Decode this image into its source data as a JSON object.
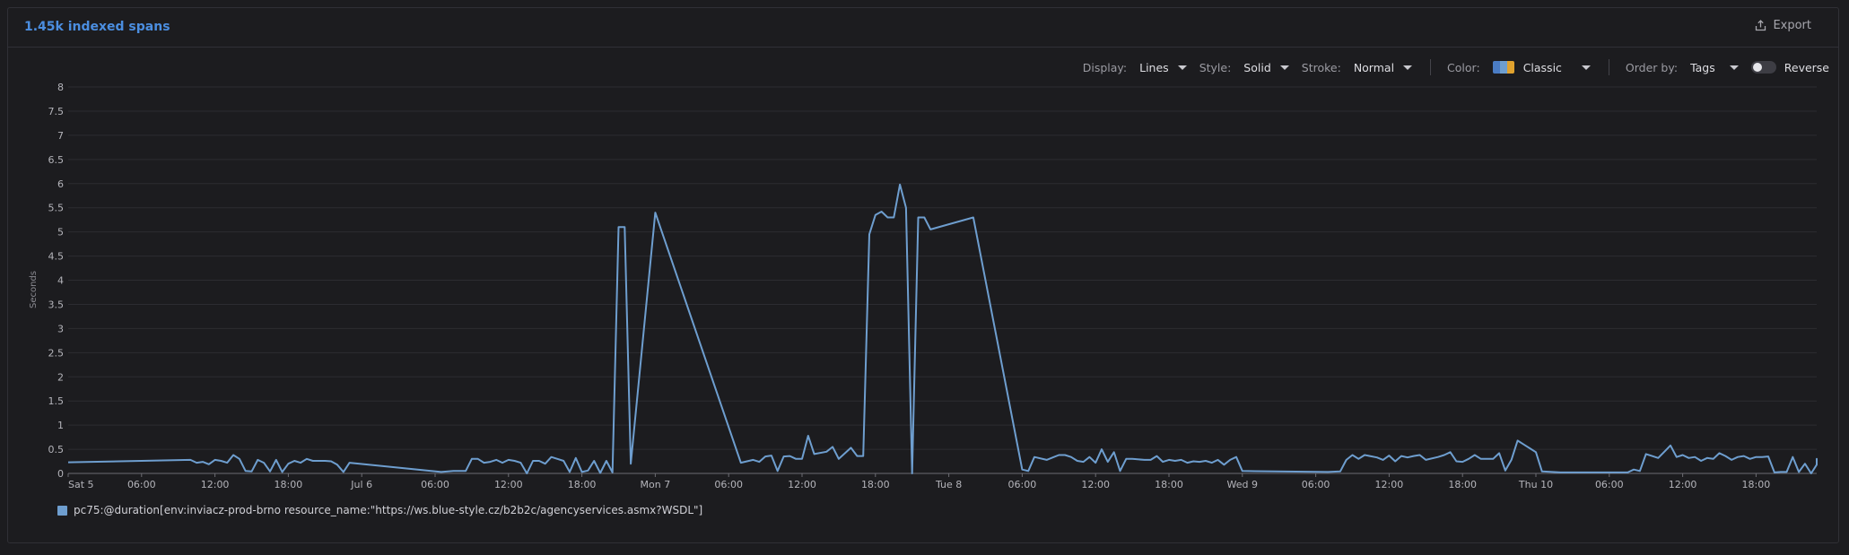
{
  "header": {
    "title": "1.45k indexed spans",
    "export_label": "Export"
  },
  "toolbar": {
    "display_label": "Display:",
    "display_value": "Lines",
    "style_label": "Style:",
    "style_value": "Solid",
    "stroke_label": "Stroke:",
    "stroke_value": "Normal",
    "color_label": "Color:",
    "color_value": "Classic",
    "order_label": "Order by:",
    "order_value": "Tags",
    "reverse_label": "Reverse",
    "reverse_on": false
  },
  "colors": {
    "accent": "#4b8ee0",
    "series": "#6e9ecf",
    "palette": [
      "#4a7cc4",
      "#6e9ecf",
      "#e0a22e"
    ]
  },
  "chart_data": {
    "type": "line",
    "ylabel": "Seconds",
    "ylim": [
      0,
      8
    ],
    "yticks": [
      "0",
      "0.5",
      "1",
      "1.5",
      "2",
      "2.5",
      "3",
      "3.5",
      "4",
      "4.5",
      "5",
      "5.5",
      "6",
      "6.5",
      "7",
      "7.5",
      "8"
    ],
    "xlim_hours": [
      0,
      116
    ],
    "xticks": [
      {
        "h": 0,
        "label": "Sat 5"
      },
      {
        "h": 6,
        "label": "06:00"
      },
      {
        "h": 12,
        "label": "12:00"
      },
      {
        "h": 18,
        "label": "18:00"
      },
      {
        "h": 24,
        "label": "Jul 6"
      },
      {
        "h": 30,
        "label": "06:00"
      },
      {
        "h": 36,
        "label": "12:00"
      },
      {
        "h": 42,
        "label": "18:00"
      },
      {
        "h": 48,
        "label": "Mon 7"
      },
      {
        "h": 54,
        "label": "06:00"
      },
      {
        "h": 60,
        "label": "12:00"
      },
      {
        "h": 66,
        "label": "18:00"
      },
      {
        "h": 72,
        "label": "Tue 8"
      },
      {
        "h": 78,
        "label": "06:00"
      },
      {
        "h": 84,
        "label": "12:00"
      },
      {
        "h": 90,
        "label": "18:00"
      },
      {
        "h": 96,
        "label": "Wed 9"
      },
      {
        "h": 102,
        "label": "06:00"
      },
      {
        "h": 108,
        "label": "12:00"
      },
      {
        "h": 114,
        "label": "18:00"
      },
      {
        "h": 120,
        "label": "Thu 10"
      },
      {
        "h": 126,
        "label": "06:00"
      },
      {
        "h": 132,
        "label": "12:00"
      },
      {
        "h": 138,
        "label": "18:00"
      }
    ],
    "series": [
      {
        "name": "pc75:@duration[env:inviacz-prod-brno resource_name:\"https://ws.blue-style.cz/b2b2c/agencyservices.asmx?WSDL\"]",
        "points": [
          [
            0.0,
            0.23
          ],
          [
            10.0,
            0.28
          ],
          [
            10.5,
            0.22
          ],
          [
            11.0,
            0.24
          ],
          [
            11.5,
            0.19
          ],
          [
            12.0,
            0.28
          ],
          [
            12.5,
            0.26
          ],
          [
            13.0,
            0.22
          ],
          [
            13.5,
            0.38
          ],
          [
            14.0,
            0.3
          ],
          [
            14.5,
            0.05
          ],
          [
            15.0,
            0.04
          ],
          [
            15.5,
            0.28
          ],
          [
            16.0,
            0.22
          ],
          [
            16.5,
            0.04
          ],
          [
            17.0,
            0.28
          ],
          [
            17.5,
            0.03
          ],
          [
            18.0,
            0.2
          ],
          [
            18.5,
            0.26
          ],
          [
            19.0,
            0.22
          ],
          [
            19.5,
            0.3
          ],
          [
            20.0,
            0.26
          ],
          [
            21.0,
            0.26
          ],
          [
            21.5,
            0.25
          ],
          [
            22.0,
            0.18
          ],
          [
            22.5,
            0.03
          ],
          [
            23.0,
            0.22
          ],
          [
            30.5,
            0.03
          ],
          [
            31.5,
            0.05
          ],
          [
            32.5,
            0.05
          ],
          [
            33.0,
            0.3
          ],
          [
            33.5,
            0.3
          ],
          [
            34.0,
            0.22
          ],
          [
            34.5,
            0.24
          ],
          [
            35.0,
            0.28
          ],
          [
            35.5,
            0.22
          ],
          [
            36.0,
            0.28
          ],
          [
            36.5,
            0.26
          ],
          [
            37.0,
            0.22
          ],
          [
            37.5,
            0.0
          ],
          [
            38.0,
            0.26
          ],
          [
            38.5,
            0.26
          ],
          [
            39.0,
            0.2
          ],
          [
            39.5,
            0.34
          ],
          [
            40.0,
            0.3
          ],
          [
            40.5,
            0.26
          ],
          [
            41.0,
            0.03
          ],
          [
            41.5,
            0.32
          ],
          [
            42.0,
            0.03
          ],
          [
            42.5,
            0.06
          ],
          [
            43.0,
            0.26
          ],
          [
            43.5,
            0.01
          ],
          [
            44.0,
            0.26
          ],
          [
            44.5,
            0.02
          ],
          [
            45.0,
            5.1
          ],
          [
            45.5,
            5.1
          ],
          [
            46.0,
            0.2
          ],
          [
            48.0,
            5.4
          ],
          [
            55.0,
            0.22
          ],
          [
            56.0,
            0.28
          ],
          [
            56.5,
            0.24
          ],
          [
            57.0,
            0.35
          ],
          [
            57.5,
            0.37
          ],
          [
            58.0,
            0.05
          ],
          [
            58.5,
            0.35
          ],
          [
            59.0,
            0.36
          ],
          [
            59.5,
            0.3
          ],
          [
            60.0,
            0.3
          ],
          [
            60.5,
            0.78
          ],
          [
            61.0,
            0.4
          ],
          [
            62.0,
            0.45
          ],
          [
            62.5,
            0.55
          ],
          [
            63.0,
            0.3
          ],
          [
            64.0,
            0.53
          ],
          [
            64.5,
            0.36
          ],
          [
            65.0,
            0.36
          ],
          [
            65.5,
            4.95
          ],
          [
            66.0,
            5.35
          ],
          [
            66.5,
            5.42
          ],
          [
            67.0,
            5.3
          ],
          [
            67.5,
            5.3
          ],
          [
            68.0,
            5.98
          ],
          [
            68.5,
            5.5
          ],
          [
            69.0,
            0.0
          ],
          [
            69.5,
            5.3
          ],
          [
            70.0,
            5.3
          ],
          [
            70.5,
            5.05
          ],
          [
            74.0,
            5.3
          ],
          [
            78.0,
            0.08
          ],
          [
            78.5,
            0.05
          ],
          [
            79.0,
            0.34
          ],
          [
            80.0,
            0.28
          ],
          [
            81.0,
            0.38
          ],
          [
            81.5,
            0.38
          ],
          [
            82.0,
            0.34
          ],
          [
            82.5,
            0.26
          ],
          [
            83.0,
            0.24
          ],
          [
            83.5,
            0.34
          ],
          [
            84.0,
            0.22
          ],
          [
            84.5,
            0.5
          ],
          [
            85.0,
            0.24
          ],
          [
            85.5,
            0.44
          ],
          [
            86.0,
            0.05
          ],
          [
            86.5,
            0.3
          ],
          [
            87.0,
            0.3
          ],
          [
            88.0,
            0.28
          ],
          [
            88.5,
            0.28
          ],
          [
            89.0,
            0.36
          ],
          [
            89.5,
            0.24
          ],
          [
            90.0,
            0.28
          ],
          [
            90.5,
            0.26
          ],
          [
            91.0,
            0.28
          ],
          [
            91.5,
            0.22
          ],
          [
            92.0,
            0.25
          ],
          [
            92.5,
            0.24
          ],
          [
            93.0,
            0.26
          ],
          [
            93.5,
            0.22
          ],
          [
            94.0,
            0.28
          ],
          [
            94.5,
            0.18
          ],
          [
            95.0,
            0.28
          ],
          [
            95.5,
            0.34
          ],
          [
            96.0,
            0.05
          ],
          [
            103.0,
            0.03
          ],
          [
            104.0,
            0.04
          ],
          [
            104.5,
            0.28
          ],
          [
            105.0,
            0.38
          ],
          [
            105.5,
            0.3
          ],
          [
            106.0,
            0.38
          ],
          [
            107.0,
            0.33
          ],
          [
            107.5,
            0.28
          ],
          [
            108.0,
            0.37
          ],
          [
            108.5,
            0.25
          ],
          [
            109.0,
            0.36
          ],
          [
            109.5,
            0.33
          ],
          [
            110.0,
            0.36
          ],
          [
            110.5,
            0.38
          ],
          [
            111.0,
            0.28
          ],
          [
            112.0,
            0.34
          ],
          [
            112.5,
            0.38
          ],
          [
            113.0,
            0.44
          ],
          [
            113.5,
            0.25
          ],
          [
            114.0,
            0.24
          ],
          [
            114.5,
            0.3
          ],
          [
            115.0,
            0.38
          ],
          [
            115.5,
            0.3
          ],
          [
            116.0,
            0.3
          ],
          [
            116.5,
            0.3
          ],
          [
            117.0,
            0.42
          ],
          [
            117.5,
            0.06
          ],
          [
            118.0,
            0.28
          ],
          [
            118.5,
            0.68
          ],
          [
            119.0,
            0.6
          ],
          [
            119.5,
            0.52
          ],
          [
            120.0,
            0.44
          ],
          [
            120.5,
            0.04
          ],
          [
            122.0,
            0.02
          ],
          [
            127.5,
            0.02
          ],
          [
            128.0,
            0.08
          ],
          [
            128.5,
            0.05
          ],
          [
            129.0,
            0.4
          ],
          [
            129.5,
            0.36
          ],
          [
            130.0,
            0.32
          ],
          [
            130.5,
            0.45
          ],
          [
            131.0,
            0.58
          ],
          [
            131.5,
            0.34
          ],
          [
            132.0,
            0.38
          ],
          [
            132.5,
            0.32
          ],
          [
            133.0,
            0.34
          ],
          [
            133.5,
            0.26
          ],
          [
            134.0,
            0.32
          ],
          [
            134.5,
            0.3
          ],
          [
            135.0,
            0.42
          ],
          [
            135.5,
            0.36
          ],
          [
            136.0,
            0.28
          ],
          [
            136.5,
            0.34
          ],
          [
            137.0,
            0.36
          ],
          [
            137.5,
            0.3
          ],
          [
            138.0,
            0.34
          ],
          [
            138.5,
            0.34
          ],
          [
            139.0,
            0.35
          ],
          [
            139.5,
            0.02
          ],
          [
            140.0,
            0.03
          ],
          [
            140.5,
            0.03
          ],
          [
            141.0,
            0.34
          ],
          [
            141.5,
            0.03
          ],
          [
            142.0,
            0.2
          ],
          [
            142.5,
            0.0
          ],
          [
            143.0,
            0.18
          ],
          [
            143.5,
            0.28
          ],
          [
            144.0,
            0.3
          ],
          [
            144.5,
            0.2
          ]
        ]
      }
    ]
  }
}
